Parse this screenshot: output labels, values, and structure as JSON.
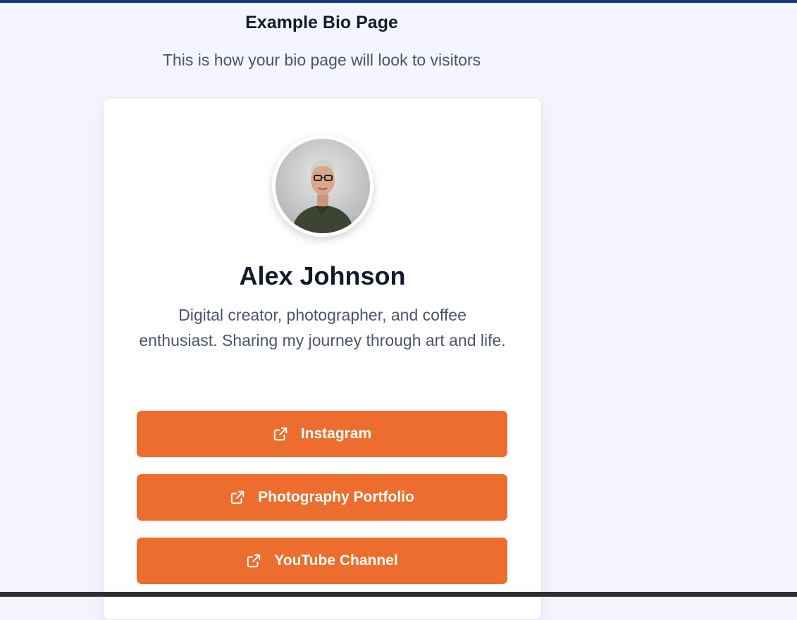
{
  "header": {
    "title": "Example Bio Page",
    "subtitle": "This is how your bio page will look to visitors"
  },
  "profile": {
    "name": "Alex Johnson",
    "bio": "Digital creator, photographer, and coffee enthusiast. Sharing my journey through art and life.",
    "avatar_icon": "profile-photo"
  },
  "links": [
    {
      "label": "Instagram",
      "icon": "external-link-icon"
    },
    {
      "label": "Photography Portfolio",
      "icon": "external-link-icon"
    },
    {
      "label": "YouTube Channel",
      "icon": "external-link-icon"
    }
  ],
  "colors": {
    "accent": "#ec6d2d",
    "top_bar": "#0b3f7f",
    "background": "#f5f5ff"
  }
}
